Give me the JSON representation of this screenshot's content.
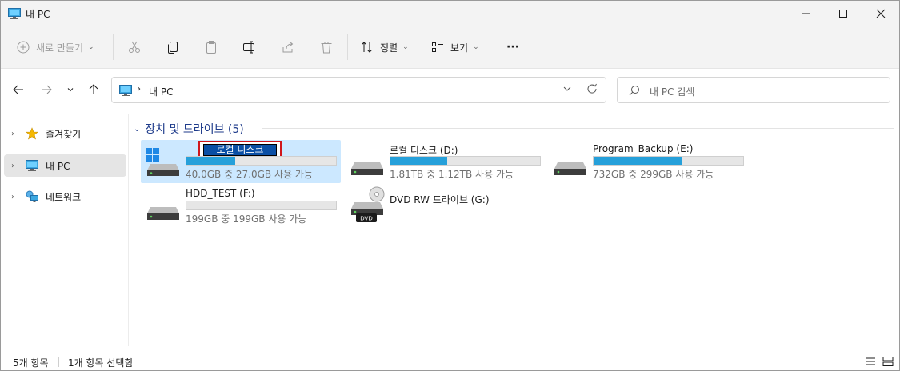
{
  "window": {
    "title": "내 PC"
  },
  "toolbar": {
    "new_label": "새로 만들기",
    "sort_label": "정렬",
    "view_label": "보기",
    "more_label": "···"
  },
  "address": {
    "path": "내 PC",
    "separator": "›"
  },
  "search": {
    "placeholder": "내 PC 검색"
  },
  "sidebar": {
    "items": [
      {
        "label": "즐겨찾기",
        "icon": "star-icon"
      },
      {
        "label": "내 PC",
        "icon": "pc-icon",
        "selected": true
      },
      {
        "label": "네트워크",
        "icon": "network-icon"
      }
    ]
  },
  "group": {
    "title": "장치 및 드라이브 (5)"
  },
  "drives": [
    {
      "name": "로컬 디스크",
      "info": "40.0GB 중 27.0GB 사용 가능",
      "used_fraction": 0.325,
      "icon": "windows-drive-icon",
      "selected": true,
      "renaming": true
    },
    {
      "name": "로컬 디스크 (D:)",
      "info": "1.81TB 중 1.12TB 사용 가능",
      "used_fraction": 0.38,
      "icon": "hard-drive-icon"
    },
    {
      "name": "Program_Backup (E:)",
      "info": "732GB 중 299GB 사용 가능",
      "used_fraction": 0.59,
      "icon": "hard-drive-icon"
    },
    {
      "name": "HDD_TEST (F:)",
      "info": "199GB 중 199GB 사용 가능",
      "used_fraction": 0.0,
      "icon": "hard-drive-icon"
    },
    {
      "name": "DVD RW 드라이브 (G:)",
      "info": "",
      "icon": "dvd-drive-icon",
      "badge": "DVD"
    }
  ],
  "status": {
    "item_count": "5개 항목",
    "selected_count": "1개 항목 선택함"
  },
  "colors": {
    "accent": "#26a0da",
    "selection": "#cce8ff",
    "header": "#1d3a8a",
    "rename_highlight": "#d0161b"
  }
}
